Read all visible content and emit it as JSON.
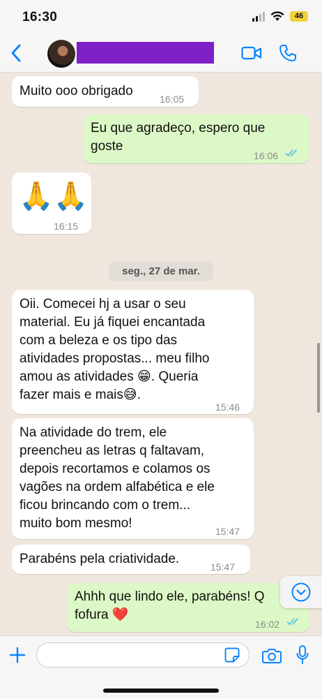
{
  "status_bar": {
    "time": "16:30",
    "battery": "46"
  },
  "header": {
    "back_icon": "chevron-left-icon",
    "video_icon": "video-camera-icon",
    "call_icon": "phone-icon"
  },
  "colors": {
    "accent": "#0a84ff",
    "outgoing_bubble": "#dcf8c6",
    "incoming_bubble": "#ffffff",
    "redaction": "#7f20c6",
    "read_ticks": "#53bdeb"
  },
  "messages": [
    {
      "direction": "in",
      "text": "Muito ooo obrigado",
      "time": "16:05"
    },
    {
      "direction": "out",
      "text": "Eu que agradeço, espero que\ngoste",
      "time": "16:06",
      "status": "read"
    },
    {
      "direction": "in",
      "text": "🙏🙏",
      "time": "16:15"
    },
    {
      "direction": "in",
      "text": "Oii. Comecei hj a usar o seu\nmaterial. Eu já fiquei encantada\ncom a beleza e os tipo das\natividades propostas... meu filho\namou as atividades 😁.  Queria\nfazer mais e mais😅.",
      "time": "15:46"
    },
    {
      "direction": "in",
      "text": "Na atividade do trem, ele\npreencheu as letras q faltavam,\ndepois recortamos e colamos os\nvagões na ordem alfabética e ele\nficou brincando com o trem...\nmuito bom mesmo!",
      "time": "15:47"
    },
    {
      "direction": "in",
      "text": "Parabéns pela criatividade.",
      "time": "15:47"
    },
    {
      "direction": "out",
      "text": "Ahhh que lindo ele, parabéns! Q\nfofura ❤️",
      "time": "16:02",
      "status": "read"
    }
  ],
  "date_separator": "seg., 27 de mar.",
  "input": {
    "placeholder": "",
    "value": ""
  },
  "input_bar": {
    "plus_icon": "plus-icon",
    "sticker_icon": "sticker-icon",
    "camera_icon": "camera-icon",
    "mic_icon": "microphone-icon"
  },
  "scroll_down_icon": "chevron-down-circle-icon"
}
